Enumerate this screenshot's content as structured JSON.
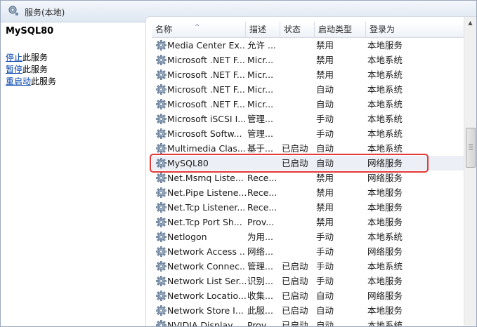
{
  "window": {
    "title": "服务(本地)"
  },
  "leftpane": {
    "service_name": "MySQL80",
    "actions": [
      {
        "link": "停止",
        "suffix": "此服务"
      },
      {
        "link": "暂停",
        "suffix": "此服务"
      },
      {
        "link": "重启动",
        "suffix": "此服务"
      }
    ]
  },
  "columns": {
    "name": "名称",
    "desc": "描述",
    "status": "状态",
    "start": "启动类型",
    "logon": "登录为"
  },
  "rows": [
    {
      "name": "Media Center Ex...",
      "desc": "允许 ...",
      "status": "",
      "start": "禁用",
      "logon": "本地服务"
    },
    {
      "name": "Microsoft .NET F...",
      "desc": "Micr...",
      "status": "",
      "start": "禁用",
      "logon": "本地系统"
    },
    {
      "name": "Microsoft .NET F...",
      "desc": "Micr...",
      "status": "",
      "start": "禁用",
      "logon": "本地系统"
    },
    {
      "name": "Microsoft .NET F...",
      "desc": "Micr...",
      "status": "",
      "start": "自动",
      "logon": "本地系统"
    },
    {
      "name": "Microsoft .NET F...",
      "desc": "Micr...",
      "status": "",
      "start": "自动",
      "logon": "本地系统"
    },
    {
      "name": "Microsoft iSCSI I...",
      "desc": "管理...",
      "status": "",
      "start": "手动",
      "logon": "本地系统"
    },
    {
      "name": "Microsoft Softw...",
      "desc": "管理...",
      "status": "",
      "start": "手动",
      "logon": "本地系统"
    },
    {
      "name": "Multimedia Clas...",
      "desc": "基于...",
      "status": "已启动",
      "start": "自动",
      "logon": "本地系统"
    },
    {
      "name": "MySQL80",
      "desc": "",
      "status": "已启动",
      "start": "自动",
      "logon": "网络服务"
    },
    {
      "name": "Net.Msmq Liste...",
      "desc": "Rece...",
      "status": "",
      "start": "禁用",
      "logon": "网络服务"
    },
    {
      "name": "Net.Pipe Listene...",
      "desc": "Rece...",
      "status": "",
      "start": "禁用",
      "logon": "本地服务"
    },
    {
      "name": "Net.Tcp Listener...",
      "desc": "Rece...",
      "status": "",
      "start": "禁用",
      "logon": "本地服务"
    },
    {
      "name": "Net.Tcp Port Sh...",
      "desc": "Prov...",
      "status": "",
      "start": "禁用",
      "logon": "本地服务"
    },
    {
      "name": "Netlogon",
      "desc": "为用...",
      "status": "",
      "start": "手动",
      "logon": "本地系统"
    },
    {
      "name": "Network Access ...",
      "desc": "网络...",
      "status": "",
      "start": "手动",
      "logon": "网络服务"
    },
    {
      "name": "Network Connec...",
      "desc": "管理...",
      "status": "已启动",
      "start": "手动",
      "logon": "本地系统"
    },
    {
      "name": "Network List Ser...",
      "desc": "识别...",
      "status": "已启动",
      "start": "手动",
      "logon": "本地服务"
    },
    {
      "name": "Network Locatio...",
      "desc": "收集...",
      "status": "已启动",
      "start": "自动",
      "logon": "网络服务"
    },
    {
      "name": "Network Store I...",
      "desc": "此服...",
      "status": "已启动",
      "start": "自动",
      "logon": "本地服务"
    },
    {
      "name": "NVIDIA Display ...",
      "desc": "Prov...",
      "status": "已启动",
      "start": "自动",
      "logon": "本地系统"
    }
  ],
  "selected_index": 8,
  "colors": {
    "highlight_border": "#e23a36",
    "link": "#0645ad"
  }
}
